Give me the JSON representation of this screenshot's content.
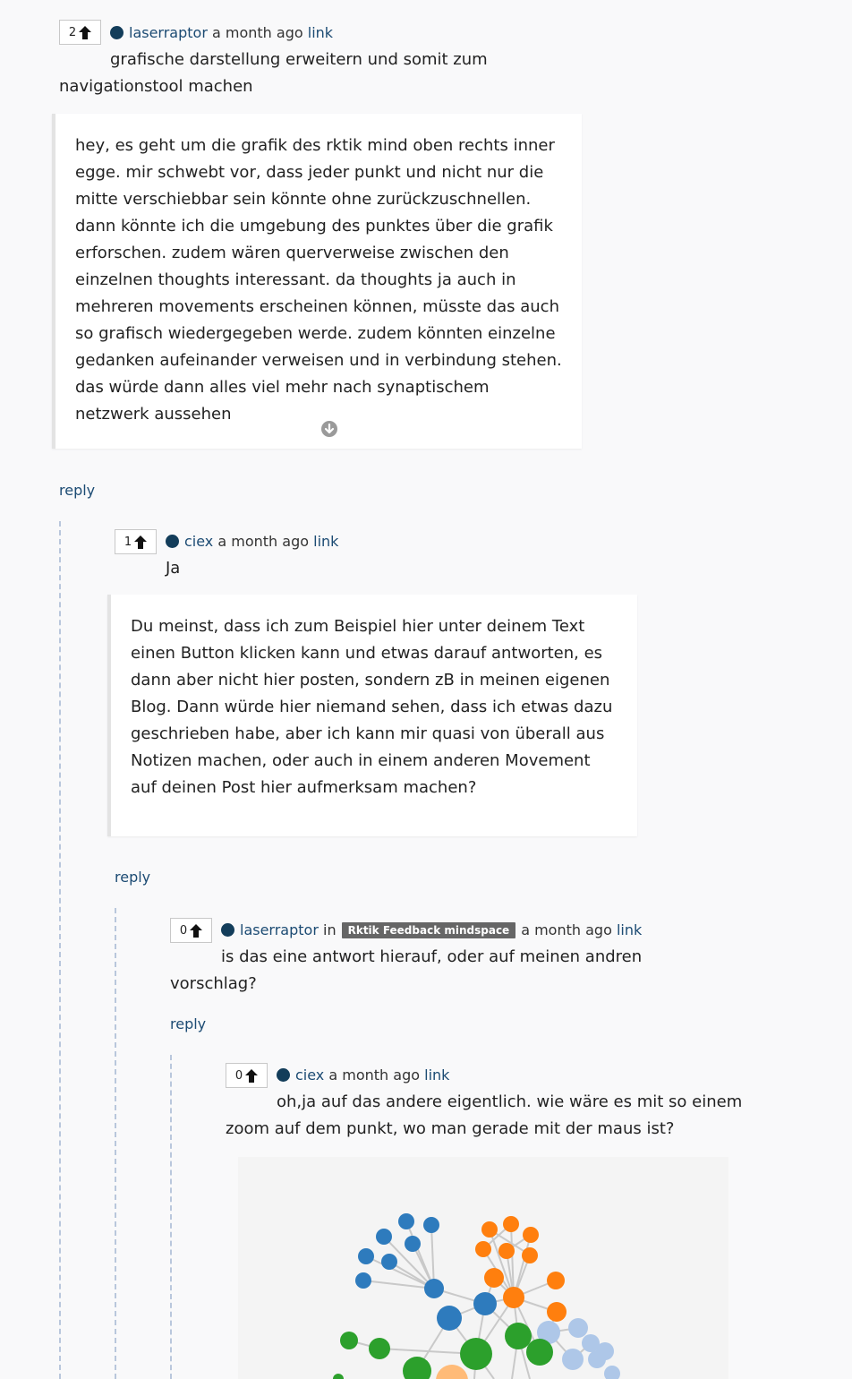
{
  "comments": [
    {
      "votes": "2",
      "user": "laserraptor",
      "time": "a month ago",
      "link": "link",
      "text": "grafische darstellung erweitern und somit zum navigationstool machen",
      "text_line1": "grafische darstellung erweitern und somit zum",
      "text_line2": "navigationstool machen",
      "quote": "hey, es geht um die grafik des rktik mind oben rechts inner egge. mir schwebt vor, dass jeder punkt und nicht nur die mitte verschiebbar sein könnte ohne zurückzuschnellen. dann könnte ich die umgebung des punktes über die grafik erforschen. zudem wären querverweise zwischen den einzelnen thoughts interessant. da thoughts ja auch in mehreren movements erscheinen können, müsste das auch so grafisch wiedergegeben werde. zudem könnten einzelne gedanken aufeinander verweisen und in verbindung stehen. das würde dann alles viel mehr nach synaptischem netzwerk aussehen",
      "reply": "reply"
    },
    {
      "votes": "1",
      "user": "ciex",
      "time": "a month ago",
      "link": "link",
      "text": "Ja",
      "quote": "Du meinst, dass ich zum Beispiel hier unter deinem Text einen Button klicken kann und etwas darauf antworten, es dann aber nicht hier posten, sondern zB in meinen eigenen Blog. Dann würde hier niemand sehen, dass ich etwas dazu geschrieben habe, aber ich kann mir quasi von überall aus Notizen machen, oder auch in einem anderen Movement auf deinen Post hier aufmerksam machen?",
      "reply": "reply"
    },
    {
      "votes": "0",
      "user": "laserraptor",
      "in": "in",
      "tag": "Rktik Feedback mindspace",
      "time": "a month ago",
      "link": "link",
      "text_line1": "is das eine antwort hierauf, oder auf meinen andren",
      "text_line2": "vorschlag?",
      "reply": "reply"
    },
    {
      "votes": "0",
      "user": "ciex",
      "time": "a month ago",
      "link": "link",
      "text_line1": "oh,ja auf das andere eigentlich. wie wäre es mit so einem",
      "text_line2": "zoom auf dem punkt, wo man gerade mit der maus ist?"
    }
  ],
  "colors": {
    "blue": "#2e7bbd",
    "orange": "#ff7f0e",
    "green": "#2ca02c",
    "lightblue": "#aec7e8",
    "peach": "#ffbb78",
    "link": "#1c4b73",
    "user_dot": "#133d5a"
  }
}
